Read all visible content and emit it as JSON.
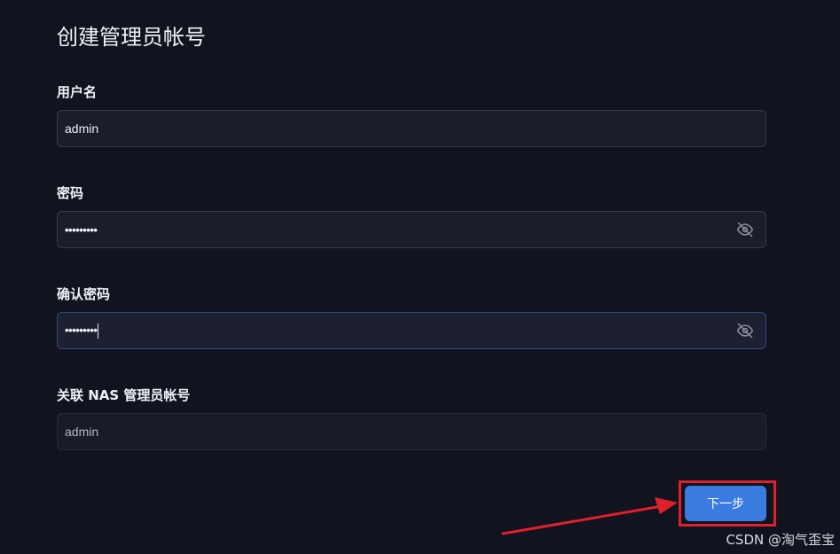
{
  "form": {
    "title": "创建管理员帐号",
    "username": {
      "label": "用户名",
      "value": "admin"
    },
    "password": {
      "label": "密码",
      "mask": "•••••••••"
    },
    "confirm_password": {
      "label": "确认密码",
      "mask": "•••••••••"
    },
    "nas_admin": {
      "label": "关联 NAS 管理员帐号",
      "value": "admin"
    },
    "next_label": "下一步"
  },
  "icons": {
    "password_toggle": "eye-off-icon",
    "confirm_toggle": "eye-off-icon",
    "annotation": "red-arrow-annotation"
  },
  "colors": {
    "background": "#11131f",
    "accent": "#3a7be0",
    "highlight": "#e0202a"
  },
  "watermark": "CSDN @淘气歪宝"
}
